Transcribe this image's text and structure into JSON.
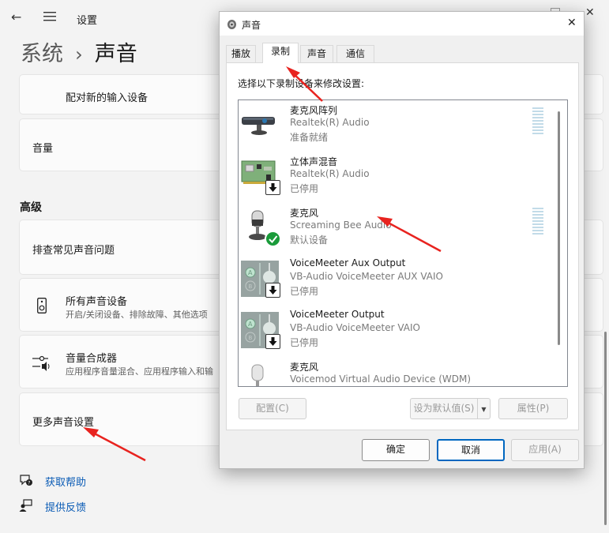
{
  "settings": {
    "app_title": "设置",
    "breadcrumb_parent": "系统",
    "breadcrumb_sep": "›",
    "breadcrumb_current": "声音",
    "pair_input": "配对新的输入设备",
    "volume": "音量",
    "advanced_header": "高级",
    "troubleshoot": "排查常见声音问题",
    "all_devices_title": "所有声音设备",
    "all_devices_sub": "开启/关闭设备、排除故障、其他选项",
    "mixer_title": "音量合成器",
    "mixer_sub": "应用程序音量混合、应用程序输入和输",
    "more_settings": "更多声音设置",
    "get_help": "获取帮助",
    "feedback": "提供反馈"
  },
  "dialog": {
    "title": "声音",
    "close": "✕",
    "tabs": [
      "播放",
      "录制",
      "声音",
      "通信"
    ],
    "active_tab": 1,
    "instruction": "选择以下录制设备来修改设置:",
    "devices": [
      {
        "name": "麦克风阵列",
        "driver": "Realtek(R) Audio",
        "status": "准备就绪",
        "icon": "webcam-mic-icon",
        "badge": ""
      },
      {
        "name": "立体声混音",
        "driver": "Realtek(R) Audio",
        "status": "已停用",
        "icon": "sound-card-icon",
        "badge": "disabled"
      },
      {
        "name": "麦克风",
        "driver": "Screaming Bee Audio",
        "status": "默认设备",
        "icon": "microphone-icon",
        "badge": "default"
      },
      {
        "name": "VoiceMeeter Aux Output",
        "driver": "VB-Audio VoiceMeeter AUX VAIO",
        "status": "已停用",
        "icon": "voicemeeter-icon",
        "badge": "disabled"
      },
      {
        "name": "VoiceMeeter Output",
        "driver": "VB-Audio VoiceMeeter VAIO",
        "status": "已停用",
        "icon": "voicemeeter-icon",
        "badge": "disabled"
      },
      {
        "name": "麦克风",
        "driver": "Voicemod Virtual Audio Device (WDM)",
        "status": "",
        "icon": "microphone-icon",
        "badge": ""
      }
    ],
    "btn_configure": "配置(C)",
    "btn_set_default": "设为默认值(S)",
    "btn_properties": "属性(P)",
    "btn_ok": "确定",
    "btn_cancel": "取消",
    "btn_apply": "应用(A)"
  },
  "colors": {
    "link": "#0a5bb5",
    "accent": "#0067c0",
    "arrow": "#e8231f",
    "level": "#c2dbe8",
    "default_badge": "#1a9b3a"
  }
}
